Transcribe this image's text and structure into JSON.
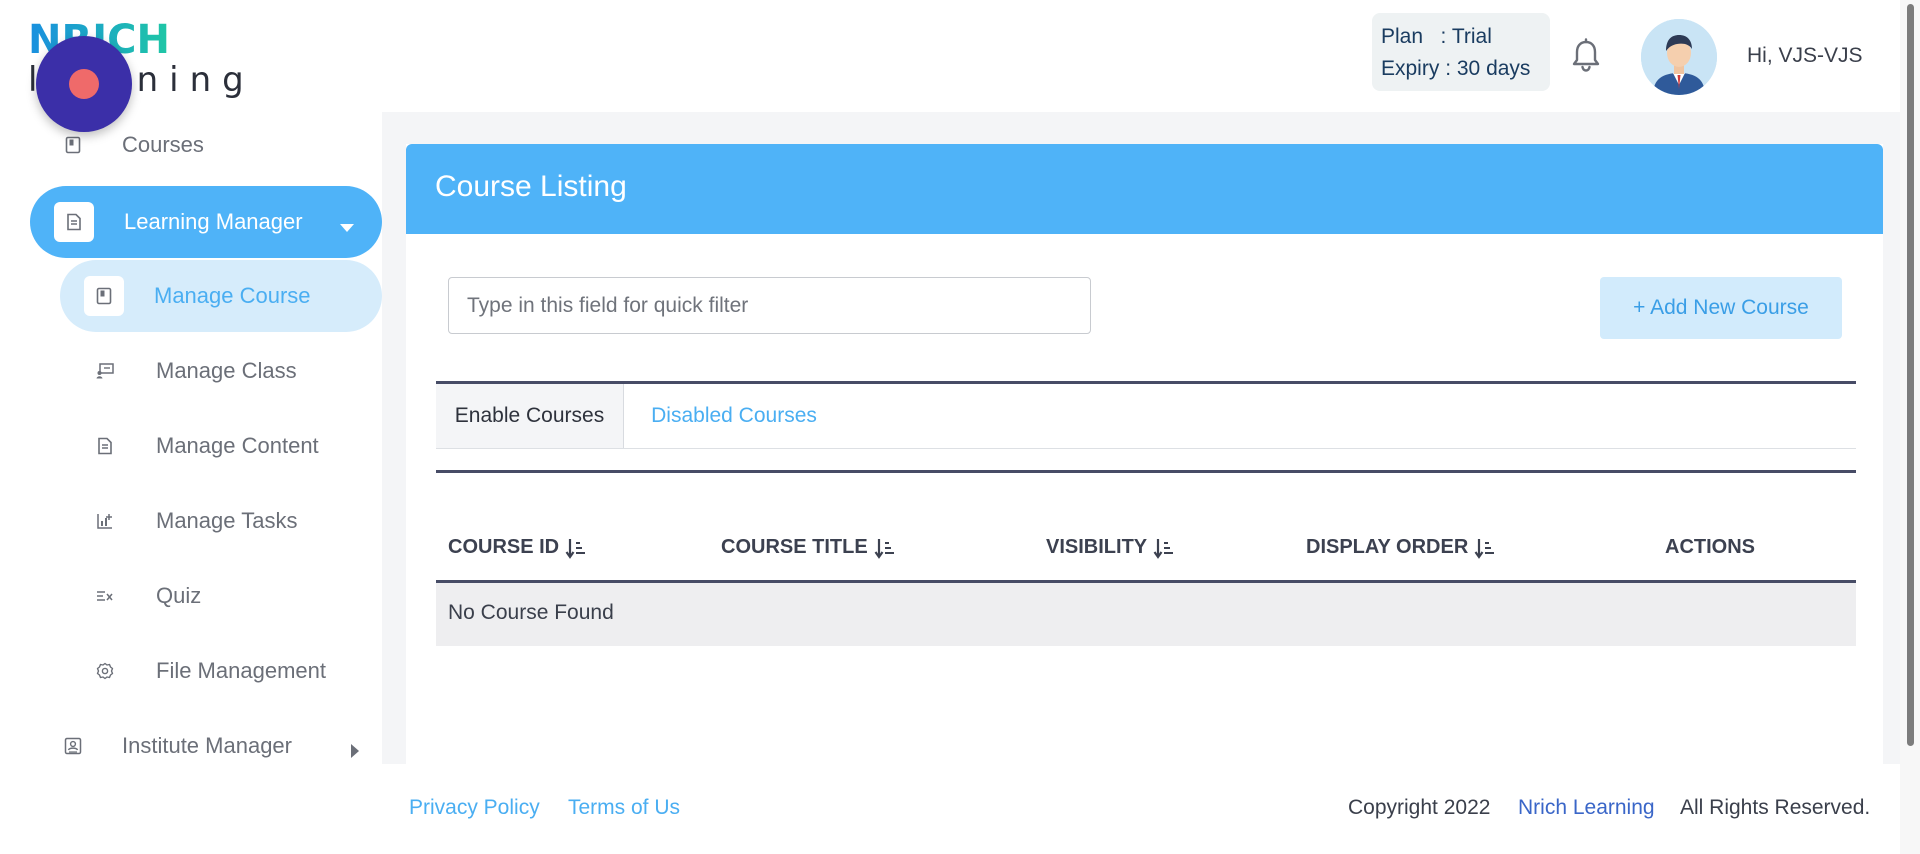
{
  "header": {
    "logo_top": "NRICH",
    "logo_bottom": "learning",
    "plan_label": "Plan",
    "plan_value": "Trial",
    "expiry_label": "Expiry",
    "expiry_value": "30 days",
    "greeting": "Hi, VJS-VJS"
  },
  "sidebar": {
    "items": [
      {
        "label": "Courses",
        "icon": "book-icon"
      },
      {
        "label": "Learning Manager",
        "icon": "document-icon"
      },
      {
        "label": "Manage Course",
        "icon": "book-icon"
      },
      {
        "label": "Manage Class",
        "icon": "classroom-icon"
      },
      {
        "label": "Manage Content",
        "icon": "document-icon"
      },
      {
        "label": "Manage Tasks",
        "icon": "chart-icon"
      },
      {
        "label": "Quiz",
        "icon": "checklist-icon"
      },
      {
        "label": "File Management",
        "icon": "gear-icon"
      },
      {
        "label": "Institute Manager",
        "icon": "id-card-icon"
      }
    ]
  },
  "main": {
    "title": "Course Listing",
    "filter_placeholder": "Type in this field for quick filter",
    "add_button": "+ Add New Course",
    "tabs": [
      {
        "label": "Enable Courses",
        "active": true
      },
      {
        "label": "Disabled Courses",
        "active": false
      }
    ],
    "columns": [
      "COURSE ID",
      "COURSE TITLE",
      "VISIBILITY",
      "DISPLAY ORDER",
      "ACTIONS"
    ],
    "empty_message": "No Course Found"
  },
  "footer": {
    "privacy": "Privacy Policy",
    "terms": "Terms of Us",
    "copyright": "Copyright 2022",
    "brand": "Nrich Learning",
    "rights": "All Rights Reserved."
  },
  "colors": {
    "accent": "#4fb3f8",
    "accent_light": "#d6ecfb",
    "rule": "#474c66",
    "link": "#4aaef2",
    "brand_link": "#3a66c8",
    "record_badge": "#3b2fa8",
    "record_dot": "#ef6a6a"
  }
}
